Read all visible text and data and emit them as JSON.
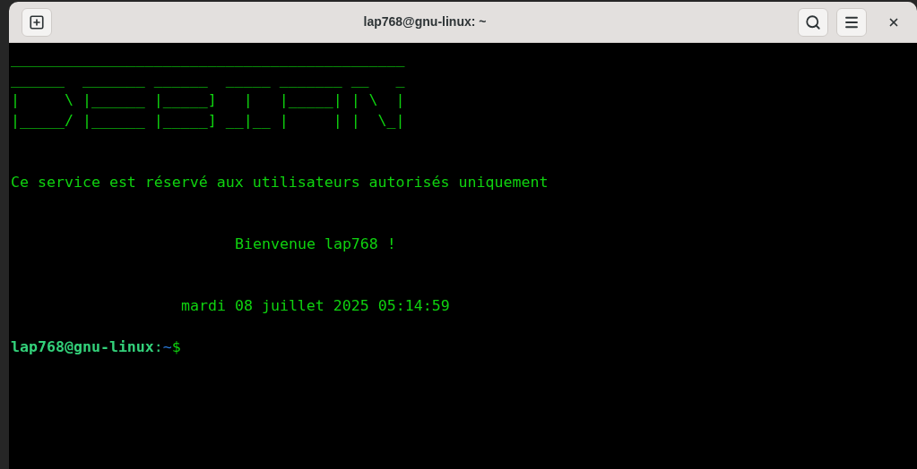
{
  "window": {
    "title": "lap768@gnu-linux: ~"
  },
  "terminal": {
    "banner": [
      "____________________________________________",
      "______  _______ ______  _____ _______ __   _",
      "|     \\ |______ |_____]   |   |_____| | \\  |",
      "|_____/ |______ |_____] __|__ |     | |  \\_|"
    ],
    "notice": "Ce service est réservé aux utilisateurs autorisés uniquement",
    "welcome": "Bienvenue lap768 !",
    "date": "mardi 08 juillet 2025 05:14:59",
    "prompt": {
      "user_host": "lap768@gnu-linux",
      "separator": ":",
      "path": "~",
      "symbol": "$"
    }
  }
}
